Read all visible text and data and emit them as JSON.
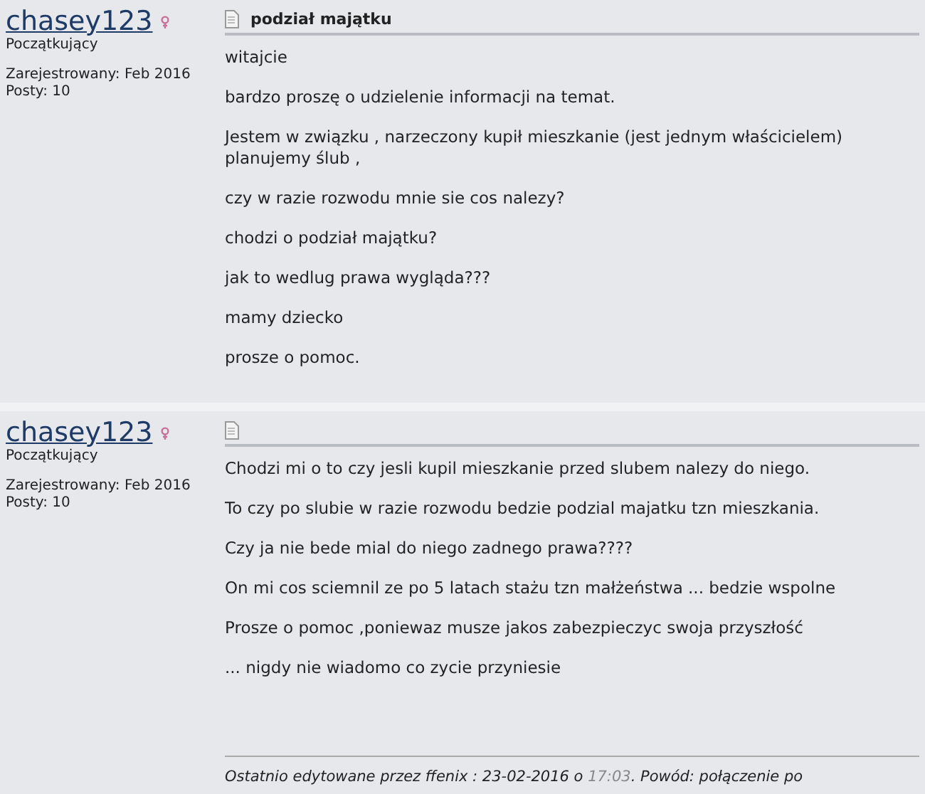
{
  "posts": [
    {
      "author": {
        "name": "chasey123",
        "rank": "Początkujący",
        "registered": "Zarejestrowany: Feb 2016",
        "posts": "Posty: 10"
      },
      "title": "podział majątku",
      "paragraphs": [
        "witajcie",
        "bardzo proszę o udzielenie informacji na temat.",
        "Jestem w związku , narzeczony kupił mieszkanie (jest jednym właścicielem) planujemy ślub ,",
        "czy w razie rozwodu mnie sie cos nalezy?",
        "chodzi o podział majątku?",
        "jak to wedlug prawa wygląda???",
        "mamy dziecko",
        "prosze o pomoc."
      ]
    },
    {
      "author": {
        "name": "chasey123",
        "rank": "Początkujący",
        "registered": "Zarejestrowany: Feb 2016",
        "posts": "Posty: 10"
      },
      "paragraphs": [
        "Chodzi mi o to czy jesli kupil mieszkanie przed slubem nalezy do niego.",
        "To czy po slubie w razie rozwodu bedzie podzial majatku tzn mieszkania.",
        "Czy ja nie bede mial do niego zadnego prawa????",
        "On mi cos sciemnil ze po 5 latach stażu tzn małżeństwa ... bedzie wspolne",
        "Prosze o pomoc ,poniewaz musze jakos zabezpieczyc swoja przyszłość",
        "... nigdy nie wiadomo co zycie przyniesie"
      ],
      "edit_note": {
        "prefix": "Ostatnio edytowane przez ffenix : 23-02-2016 o ",
        "time": "17:03",
        "suffix": ". Powód: połączenie po"
      }
    }
  ]
}
